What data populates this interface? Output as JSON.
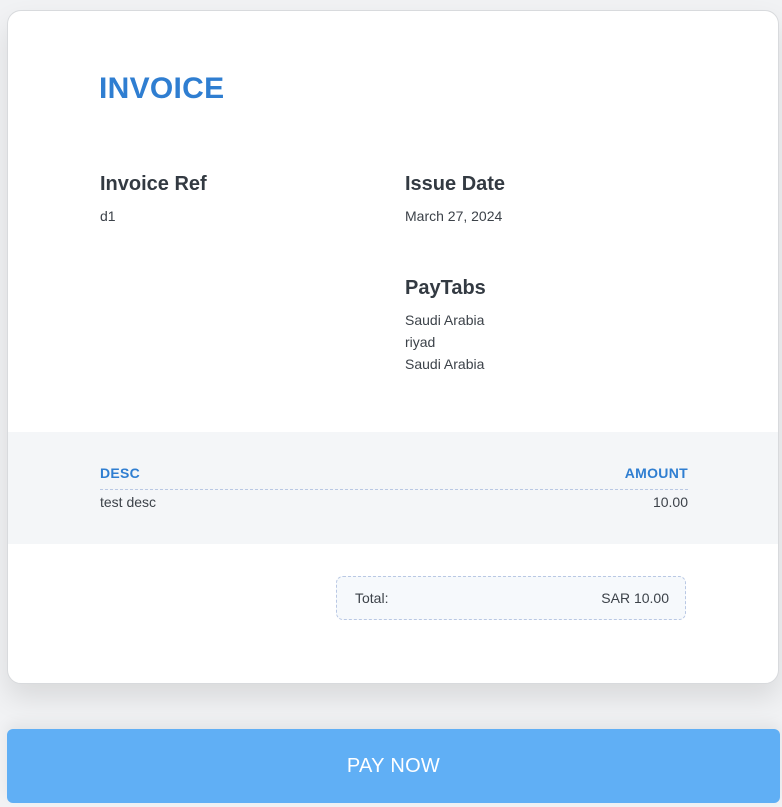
{
  "invoice": {
    "title": "INVOICE",
    "ref_label": "Invoice Ref",
    "ref_value": "d1",
    "date_label": "Issue Date",
    "date_value": "March 27, 2024",
    "company": {
      "name": "PayTabs",
      "lines": [
        "Saudi Arabia",
        "riyad",
        "Saudi Arabia"
      ]
    }
  },
  "items": {
    "headers": {
      "desc": "DESC",
      "amount": "AMOUNT"
    },
    "rows": [
      {
        "desc": "test desc",
        "amount": "10.00"
      }
    ]
  },
  "total": {
    "label": "Total:",
    "value": "SAR 10.00"
  },
  "actions": {
    "pay_label": "PAY NOW"
  },
  "colors": {
    "accent": "#2f7ed1",
    "button": "#60aff5",
    "band": "#f4f6f8"
  }
}
